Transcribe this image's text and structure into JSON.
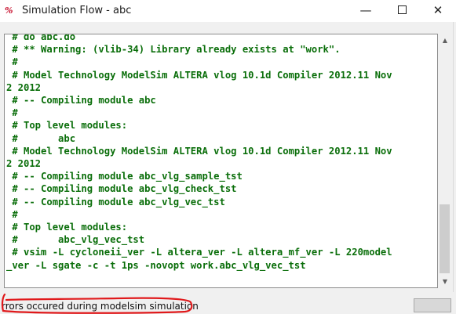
{
  "window": {
    "title": "Simulation Flow - abc",
    "app_icon_text": "%",
    "minimize_glyph": "—",
    "close_glyph": "✕"
  },
  "console": {
    "lines": [
      " # do abc.do",
      " # ** Warning: (vlib-34) Library already exists at \"work\".",
      " #",
      " # Model Technology ModelSim ALTERA vlog 10.1d Compiler 2012.11 Nov",
      "2 2012",
      " # -- Compiling module abc",
      " #",
      " # Top level modules:",
      " #       abc",
      " # Model Technology ModelSim ALTERA vlog 10.1d Compiler 2012.11 Nov",
      "2 2012",
      " # -- Compiling module abc_vlg_sample_tst",
      " # -- Compiling module abc_vlg_check_tst",
      " # -- Compiling module abc_vlg_vec_tst",
      " #",
      " # Top level modules:",
      " #       abc_vlg_vec_tst",
      " # vsim -L cycloneii_ver -L altera_ver -L altera_mf_ver -L 220model",
      "_ver -L sgate -c -t 1ps -novopt work.abc_vlg_vec_tst"
    ]
  },
  "scrollbar": {
    "up_arrow": "▲",
    "down_arrow": "▼"
  },
  "status": {
    "message": "rrors occured during modelsim simulation"
  },
  "colors": {
    "console_text": "#0a6e0a",
    "annotation": "#e0191b"
  }
}
